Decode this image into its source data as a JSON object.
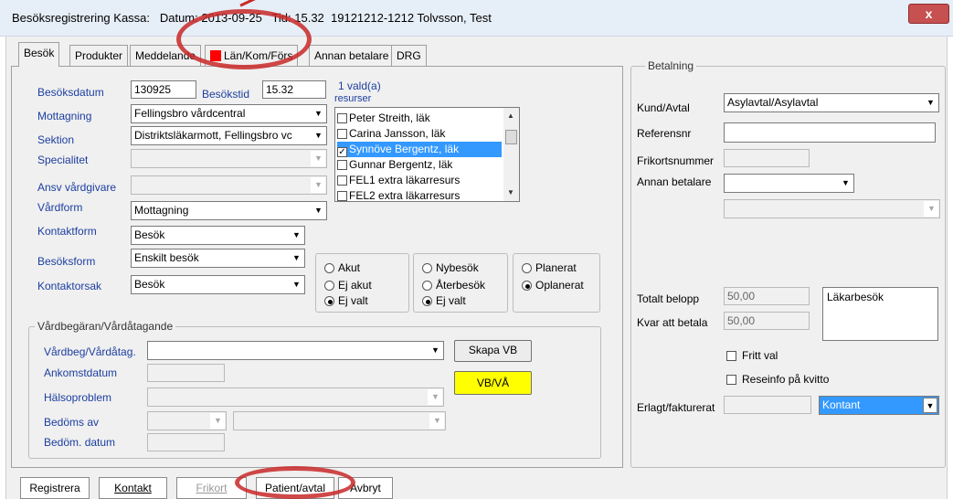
{
  "window": {
    "title": "Besöksregistrering Kassa:   Datum: 2013-09-25   Tid: 15.32  19121212-1212 Tolvsson, Test",
    "close_label": "x"
  },
  "tabs": [
    {
      "label": "Besök"
    },
    {
      "label": "Produkter"
    },
    {
      "label": "Meddelande"
    },
    {
      "label": "Län/Kom/Förs"
    },
    {
      "label": "Annan betalare"
    },
    {
      "label": "DRG"
    }
  ],
  "form": {
    "besoksdatum_label": "Besöksdatum",
    "besoksdatum_value": "130925",
    "besokstid_label": "Besökstid",
    "besokstid_value": "15.32",
    "mottagning_label": "Mottagning",
    "mottagning_value": "Fellingsbro vårdcentral",
    "sektion_label": "Sektion",
    "sektion_value": "Distriktsläkarmott, Fellingsbro vc",
    "specialitet_label": "Specialitet",
    "ansv_label": "Ansv vårdgivare",
    "vardform_label": "Vårdform",
    "vardform_value": "Mottagning",
    "kontaktform_label": "Kontaktform",
    "kontaktform_value": "Besök",
    "besoksform_label": "Besöksform",
    "besoksform_value": "Enskilt besök",
    "kontaktorsak_label": "Kontaktorsak",
    "kontaktorsak_value": "Besök"
  },
  "resources": {
    "header_line1": "1 vald(a)",
    "header_line2": "resurser",
    "items": [
      {
        "label": "Peter Streith, läk",
        "checked": false,
        "selected": false
      },
      {
        "label": "Carina Jansson, läk",
        "checked": false,
        "selected": false
      },
      {
        "label": "Synnöve Bergentz, läk",
        "checked": true,
        "selected": true
      },
      {
        "label": "Gunnar Bergentz, läk",
        "checked": false,
        "selected": false
      },
      {
        "label": "FEL1 extra läkarresurs",
        "checked": false,
        "selected": false
      },
      {
        "label": "FEL2 extra läkarresurs",
        "checked": false,
        "selected": false
      }
    ]
  },
  "radios": {
    "g1": [
      {
        "label": "Akut",
        "on": false
      },
      {
        "label": "Ej akut",
        "on": false
      },
      {
        "label": "Ej valt",
        "on": true
      }
    ],
    "g2": [
      {
        "label": "Nybesök",
        "on": false
      },
      {
        "label": "Återbesök",
        "on": false
      },
      {
        "label": "Ej valt",
        "on": true
      }
    ],
    "g3": [
      {
        "label": "Planerat",
        "on": false
      },
      {
        "label": "Oplanerat",
        "on": true
      }
    ]
  },
  "vardbegaran": {
    "legend": "Vårdbegäran/Vårdåtagande",
    "vardbeg_label": "Vårdbeg/Vårdåtag.",
    "ankomst_label": "Ankomstdatum",
    "halso_label": "Hälsoproblem",
    "bedoms_label": "Bedöms av",
    "bedomdatum_label": "Bedöm. datum",
    "skapa_vb": "Skapa VB",
    "vb_va": "VB/VÅ"
  },
  "betalning": {
    "legend": "Betalning",
    "kund_label": "Kund/Avtal",
    "kund_value": "Asylavtal/Asylavtal",
    "referens_label": "Referensnr",
    "frikort_label": "Frikortsnummer",
    "annan_label": "Annan betalare",
    "totalt_label": "Totalt belopp",
    "totalt_value": "50,00",
    "kvar_label": "Kvar att betala",
    "kvar_value": "50,00",
    "note_value": "Läkarbesök",
    "fritt_val": "Fritt val",
    "reseinfo": "Reseinfo på kvitto",
    "erlagt_label": "Erlagt/fakturerat",
    "erlagt_value": "Kontant"
  },
  "bottom": {
    "registrera": "Registrera",
    "kontakt": "Kontakt",
    "frikort": "Frikort",
    "patient": "Patient/avtal",
    "avbryt": "Avbryt"
  },
  "colors": {
    "label_blue": "#1c3ea0",
    "selection": "#3399ff",
    "highlight_circle": "#c82828",
    "yellow_button": "#ffff00"
  }
}
